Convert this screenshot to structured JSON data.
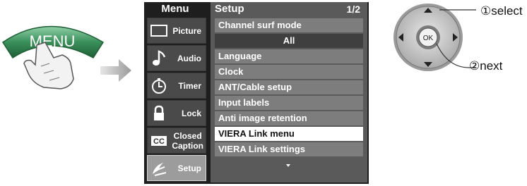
{
  "menu_button": {
    "label": "MENU"
  },
  "screen": {
    "menu_heading": "Menu",
    "side_menu": [
      {
        "label": "Picture",
        "icon": "picture-icon"
      },
      {
        "label": "Audio",
        "icon": "audio-note-icon"
      },
      {
        "label": "Timer",
        "icon": "timer-clock-icon"
      },
      {
        "label": "Lock",
        "icon": "padlock-icon"
      },
      {
        "label": "Closed Caption",
        "label_line1": "Closed",
        "label_line2": "Caption",
        "icon": "cc-icon"
      },
      {
        "label": "Setup",
        "icon": "setup-satellite-icon",
        "active": true
      }
    ],
    "setup": {
      "title": "Setup",
      "page": "1/2",
      "items": [
        {
          "label": "Channel surf mode"
        },
        {
          "label": "All",
          "type": "value"
        },
        {
          "label": "Language"
        },
        {
          "label": "Clock"
        },
        {
          "label": "ANT/Cable setup"
        },
        {
          "label": "Input labels"
        },
        {
          "label": "Anti image retention"
        },
        {
          "label": "VIERA Link menu",
          "selected": true
        },
        {
          "label": "VIERA Link settings"
        }
      ]
    }
  },
  "remote": {
    "ok_label": "OK",
    "select_caption": "①select",
    "next_caption": "②next"
  },
  "colors": {
    "screen_bg": "#1e1e1e",
    "menu_row": "#7d7d7d",
    "selected_row": "#ffffff",
    "menu_button_green": "#2e7d4a"
  }
}
